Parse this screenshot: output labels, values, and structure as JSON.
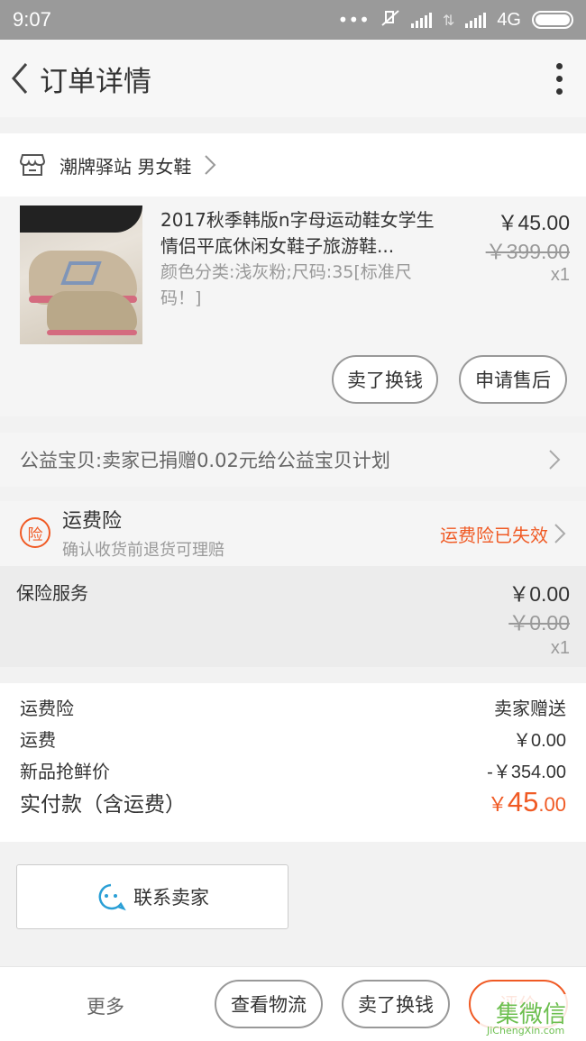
{
  "status_bar": {
    "time": "9:07",
    "network": "4G"
  },
  "nav": {
    "title": "订单详情"
  },
  "shop": {
    "name": "潮牌驿站 男女鞋"
  },
  "item": {
    "title": "2017秋季韩版n字母运动鞋女学生情侣平底休闲女鞋子旅游鞋...",
    "sku": "颜色分类:浅灰粉;尺码:35[标准尺码！]",
    "price": "￥45.00",
    "original_price": "￥399.00",
    "quantity": "x1",
    "buttons": {
      "sell": "卖了换钱",
      "aftersale": "申请售后"
    }
  },
  "charity": {
    "text": "公益宝贝:卖家已捐赠0.02元给公益宝贝计划"
  },
  "insurance": {
    "badge": "险",
    "title": "运费险",
    "subtitle": "确认收货前退货可理赔",
    "status": "运费险已失效",
    "status_color": "#f05a24"
  },
  "service": {
    "name": "保险服务",
    "price": "￥0.00",
    "original_price": "￥0.00",
    "quantity": "x1"
  },
  "summary": {
    "rows": [
      {
        "label": "运费险",
        "value": "卖家赠送"
      },
      {
        "label": "运费",
        "value": "￥0.00"
      },
      {
        "label": "新品抢鲜价",
        "value": "-￥354.00"
      }
    ],
    "total_label": "实付款（含运费）",
    "total_currency": "￥",
    "total_int": "45",
    "total_dec": ".00"
  },
  "contact": {
    "label": "联系卖家",
    "icon": "chat-face-icon"
  },
  "bottom": {
    "more": "更多",
    "logistics": "查看物流",
    "sell": "卖了换钱",
    "review": "评价"
  },
  "watermark": {
    "logo": "集微信",
    "url": "JiChengXin.com"
  },
  "colors": {
    "accent": "#f05a24",
    "blue": "#2a9fd6",
    "watermark_green": "#6cbf4f"
  }
}
